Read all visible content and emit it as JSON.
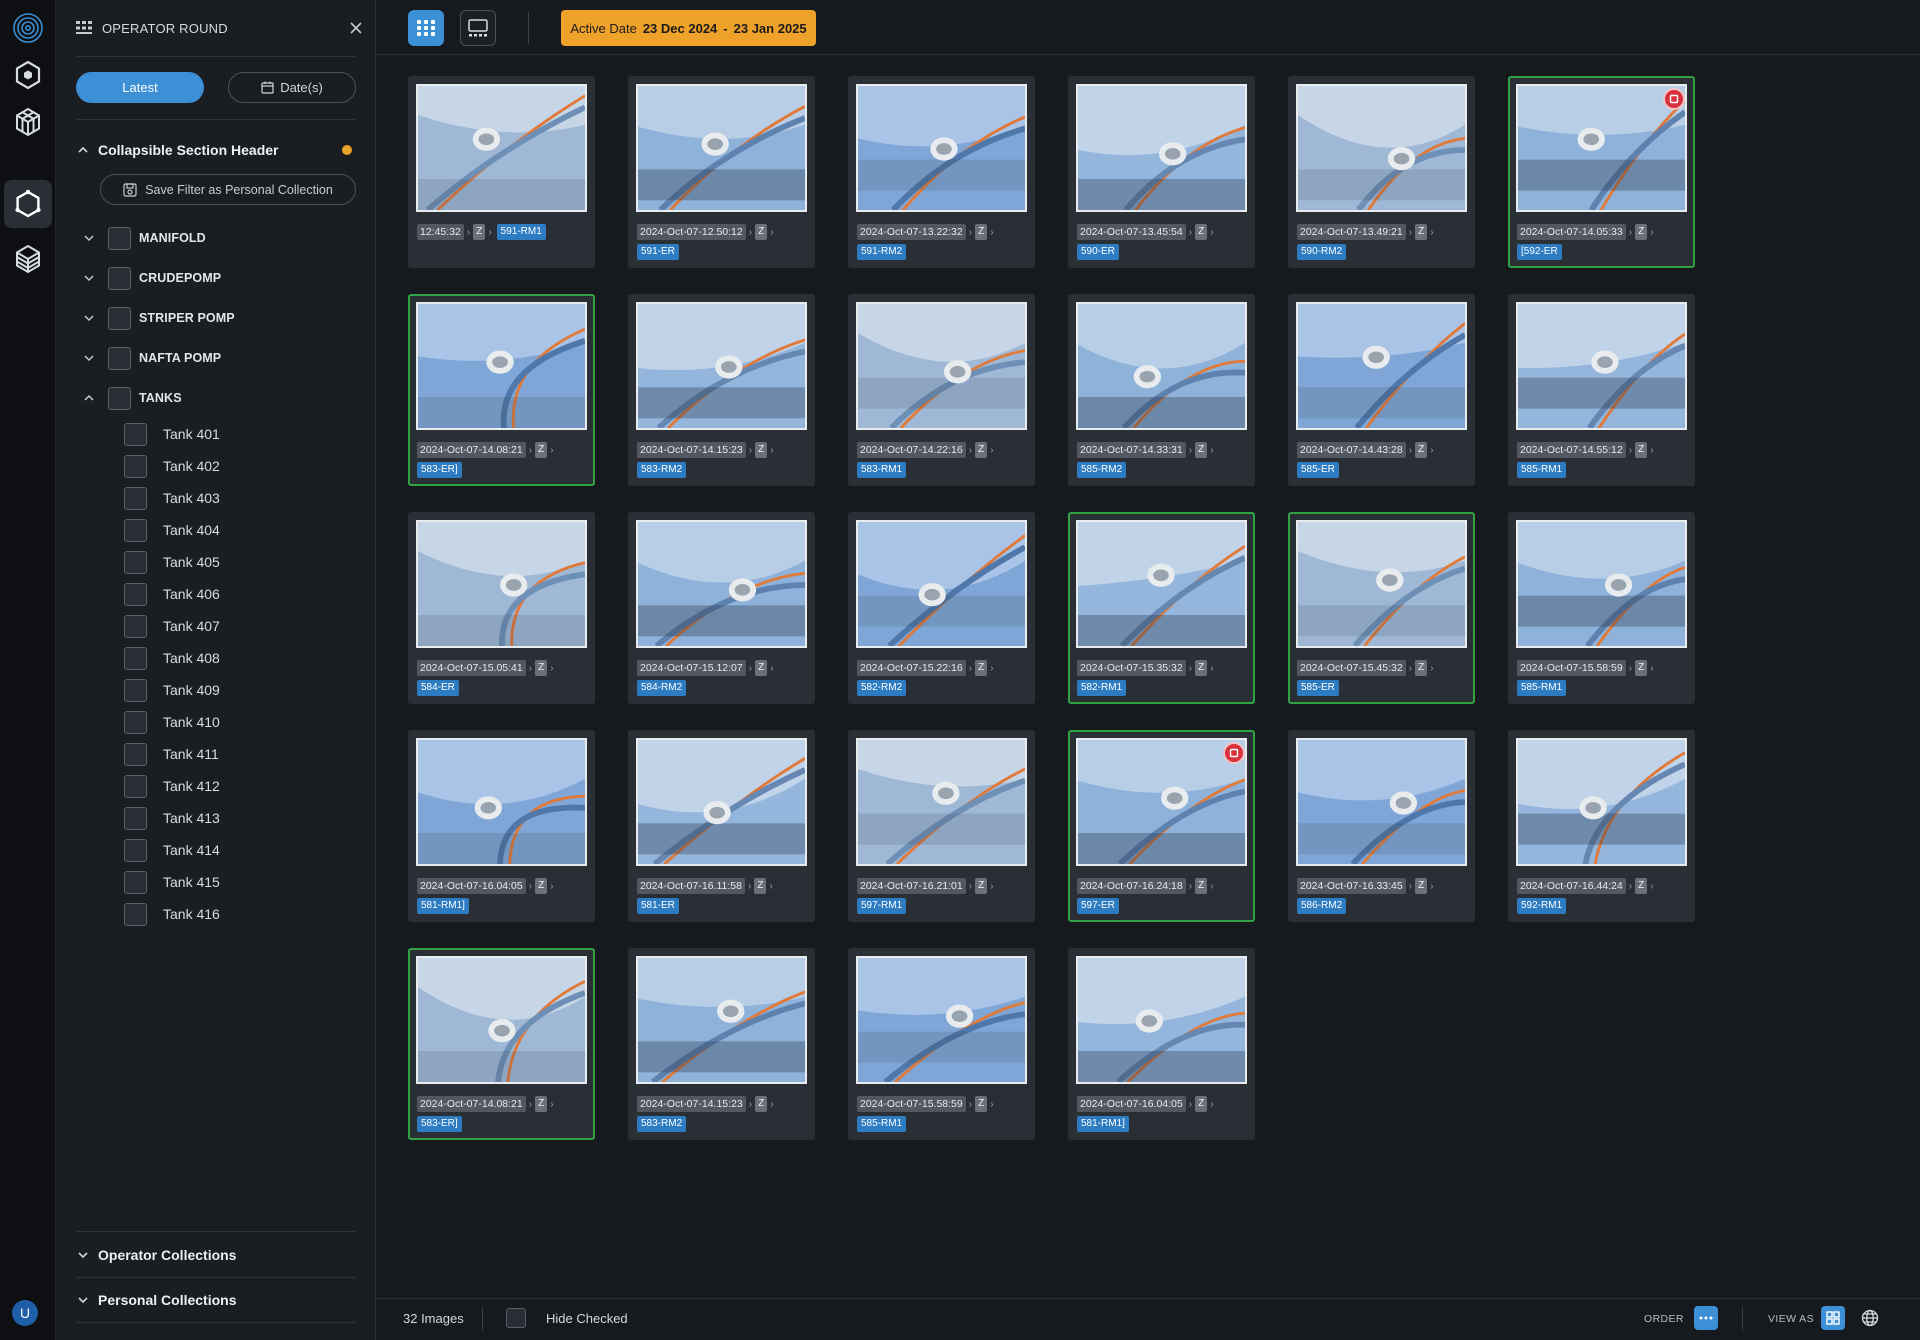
{
  "sidebar": {
    "title": "OPERATOR ROUND",
    "latest_label": "Latest",
    "dates_label": "Date(s)",
    "section_title": "Collapsible Section Header",
    "save_filter_label": "Save Filter as Personal Collection",
    "groups": [
      "MANIFOLD",
      "CRUDEPOMP",
      "STRIPER POMP",
      "NAFTA POMP",
      "TANKS"
    ],
    "tanks": [
      "Tank 401",
      "Tank 402",
      "Tank 403",
      "Tank 404",
      "Tank 405",
      "Tank 406",
      "Tank 407",
      "Tank 408",
      "Tank 409",
      "Tank 410",
      "Tank 411",
      "Tank 412",
      "Tank 413",
      "Tank 414",
      "Tank 415",
      "Tank 416"
    ],
    "operator_collections": "Operator Collections",
    "personal_collections": "Personal Collections"
  },
  "user": {
    "initial": "U"
  },
  "topbar": {
    "active_date_label": "Active Date",
    "date_from": "23 Dec 2024",
    "date_sep": "-",
    "date_to": "23 Jan 2025"
  },
  "images": [
    {
      "ts": "12:45:32",
      "z": "Z",
      "tag": "591-RM1",
      "selected": false,
      "alert": false,
      "tag_inline": true
    },
    {
      "ts": "2024-Oct-07-12.50:12",
      "z": "Z",
      "tag": "591-ER",
      "selected": false,
      "alert": false
    },
    {
      "ts": "2024-Oct-07-13.22:32",
      "z": "Z",
      "tag": "591-RM2",
      "selected": false,
      "alert": false
    },
    {
      "ts": "2024-Oct-07-13.45:54",
      "z": "Z",
      "tag": "590-ER",
      "selected": false,
      "alert": false
    },
    {
      "ts": "2024-Oct-07-13.49:21",
      "z": "Z",
      "tag": "590-RM2",
      "selected": false,
      "alert": false
    },
    {
      "ts": "2024-Oct-07-14.05:33",
      "z": "Z",
      "tag": "[592-ER",
      "selected": true,
      "alert": true
    },
    {
      "ts": "2024-Oct-07-14.08:21",
      "z": "Z",
      "tag": "583-ER]",
      "selected": true,
      "alert": false
    },
    {
      "ts": "2024-Oct-07-14.15:23",
      "z": "Z",
      "tag": "583-RM2",
      "selected": false,
      "alert": false
    },
    {
      "ts": "2024-Oct-07-14.22:16",
      "z": "Z",
      "tag": "583-RM1",
      "selected": false,
      "alert": false
    },
    {
      "ts": "2024-Oct-07-14.33:31",
      "z": "Z",
      "tag": "585-RM2",
      "selected": false,
      "alert": false
    },
    {
      "ts": "2024-Oct-07-14.43:28",
      "z": "Z",
      "tag": "585-ER",
      "selected": false,
      "alert": false
    },
    {
      "ts": "2024-Oct-07-14.55:12",
      "z": "Z",
      "tag": "585-RM1",
      "selected": false,
      "alert": false
    },
    {
      "ts": "2024-Oct-07-15.05:41",
      "z": "Z",
      "tag": "584-ER",
      "selected": false,
      "alert": false
    },
    {
      "ts": "2024-Oct-07-15.12:07",
      "z": "Z",
      "tag": "584-RM2",
      "selected": false,
      "alert": false
    },
    {
      "ts": "2024-Oct-07-15.22:16",
      "z": "Z",
      "tag": "582-RM2",
      "selected": false,
      "alert": false
    },
    {
      "ts": "2024-Oct-07-15.35:32",
      "z": "Z",
      "tag": "582-RM1",
      "selected": true,
      "alert": false
    },
    {
      "ts": "2024-Oct-07-15.45:32",
      "z": "Z",
      "tag": "585-ER",
      "selected": true,
      "alert": false
    },
    {
      "ts": "2024-Oct-07-15.58:59",
      "z": "Z",
      "tag": "585-RM1",
      "selected": false,
      "alert": false
    },
    {
      "ts": "2024-Oct-07-16.04:05",
      "z": "Z",
      "tag": "581-RM1]",
      "selected": false,
      "alert": false
    },
    {
      "ts": "2024-Oct-07-16.11:58",
      "z": "Z",
      "tag": "581-ER",
      "selected": false,
      "alert": false
    },
    {
      "ts": "2024-Oct-07-16.21:01",
      "z": "Z",
      "tag": "597-RM1",
      "selected": false,
      "alert": false
    },
    {
      "ts": "2024-Oct-07-16.24:18",
      "z": "Z",
      "tag": "597-ER",
      "selected": true,
      "alert": true
    },
    {
      "ts": "2024-Oct-07-16.33:45",
      "z": "Z",
      "tag": "586-RM2",
      "selected": false,
      "alert": false
    },
    {
      "ts": "2024-Oct-07-16.44:24",
      "z": "Z",
      "tag": "592-RM1",
      "selected": false,
      "alert": false
    },
    {
      "ts": "2024-Oct-07-14.08:21",
      "z": "Z",
      "tag": "583-ER]",
      "selected": true,
      "alert": false
    },
    {
      "ts": "2024-Oct-07-14.15:23",
      "z": "Z",
      "tag": "583-RM2",
      "selected": false,
      "alert": false
    },
    {
      "ts": "2024-Oct-07-15.58:59",
      "z": "Z",
      "tag": "585-RM1",
      "selected": false,
      "alert": false
    },
    {
      "ts": "2024-Oct-07-16.04:05",
      "z": "Z",
      "tag": "581-RM1]",
      "selected": false,
      "alert": false
    }
  ],
  "bottombar": {
    "image_count": "32 Images",
    "hide_checked_label": "Hide Checked",
    "order_label": "ORDER",
    "view_as_label": "VIEW AS"
  },
  "colors": {
    "accent": "#3d8fd6",
    "date_badge": "#efa22a",
    "selected_border": "#2fa343",
    "alert": "#d9323d",
    "status_dot": "#e8a32a"
  }
}
